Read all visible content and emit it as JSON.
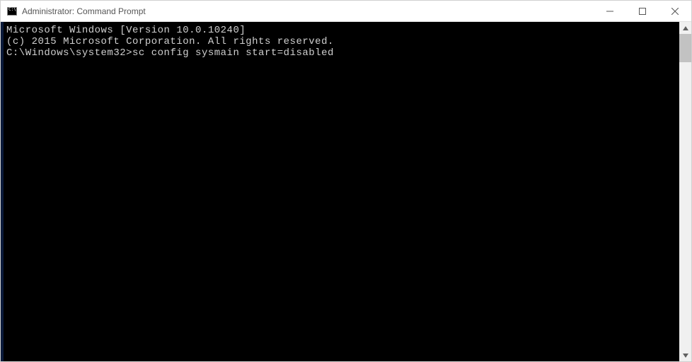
{
  "window": {
    "title": "Administrator: Command Prompt"
  },
  "terminal": {
    "line1": "Microsoft Windows [Version 10.0.10240]",
    "line2": "(c) 2015 Microsoft Corporation. All rights reserved.",
    "blank": "",
    "prompt": "C:\\Windows\\system32>",
    "command": "sc config sysmain start=disabled"
  }
}
